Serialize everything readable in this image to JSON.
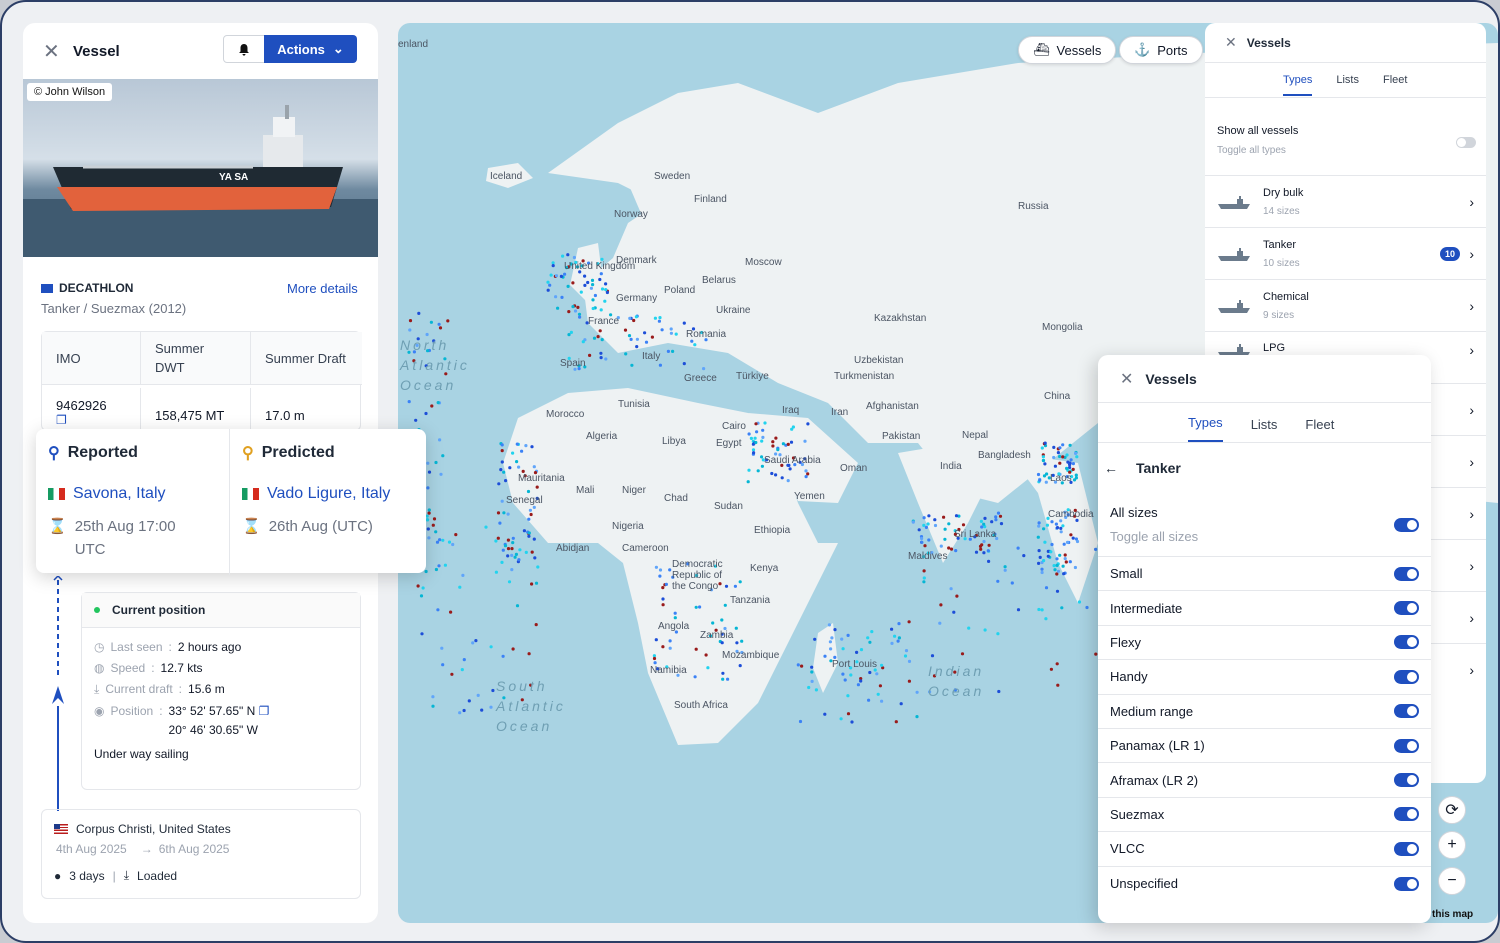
{
  "vessel_panel": {
    "title": "Vessel",
    "actions_label": "Actions",
    "photo_credit": "© John Wilson",
    "vessel_name": "DECATHLON",
    "vessel_type": "Tanker / Suezmax (2012)",
    "more_details": "More details",
    "specs": {
      "headers": [
        "IMO",
        "Summer DWT",
        "Summer Draft"
      ],
      "values": [
        "9462926",
        "158,475 MT",
        "17.0 m"
      ]
    },
    "reported": {
      "title": "Reported",
      "port": "Savona, Italy",
      "time": "25th Aug 17:00 UTC"
    },
    "predicted": {
      "title": "Predicted",
      "port": "Vado Ligure, Italy",
      "time": "26th Aug (UTC)"
    },
    "current_position": {
      "title": "Current position",
      "last_seen_label": "Last seen",
      "last_seen": "2 hours ago",
      "speed_label": "Speed",
      "speed": "12.7 kts",
      "draft_label": "Current draft",
      "draft": "15.6 m",
      "position_label": "Position",
      "lat": "33° 52' 57.65\" N",
      "lon": "20° 46' 30.65\" W",
      "status": "Under way sailing"
    },
    "previous_port": {
      "name": "Corpus Christi, United States",
      "arrival": "4th Aug 2025",
      "departure": "6th Aug 2025",
      "duration": "3 days",
      "load_state": "Loaded"
    }
  },
  "map": {
    "buttons": {
      "vessels": "Vessels",
      "ports": "Ports"
    },
    "attribution": "this map",
    "labels": [
      "Iceland",
      "Sweden",
      "Finland",
      "Norway",
      "Russia",
      "Denmark",
      "United Kingdom",
      "Belarus",
      "Moscow",
      "Poland",
      "Germany",
      "Ukraine",
      "France",
      "Kazakhstan",
      "Mongolia",
      "Romania",
      "Spain",
      "Italy",
      "Uzbekistan",
      "Türkiye",
      "Turkmenistan",
      "Greece",
      "Afghanistan",
      "Tunisia",
      "Iraq",
      "Iran",
      "China",
      "Morocco",
      "Algeria",
      "Libya",
      "Egypt",
      "Cairo",
      "Pakistan",
      "Nepal",
      "Bangladesh",
      "Saudi Arabia",
      "India",
      "Oman",
      "Laos",
      "Mauritania",
      "Mali",
      "Niger",
      "Chad",
      "Sudan",
      "Yemen",
      "Senegal",
      "Nigeria",
      "Ethiopia",
      "Cambodia",
      "Sri Lanka",
      "Abidjan",
      "Cameroon",
      "Democratic Republic of the Congo",
      "Kenya",
      "Tanzania",
      "Maldives",
      "Angola",
      "Zambia",
      "Mozambique",
      "Namibia",
      "Port Louis",
      "South Africa",
      "Finland"
    ],
    "oceans": {
      "north_atlantic": "North\nAtlantic\nOcean",
      "south_atlantic": "South\nAtlantic\nOcean",
      "indian": "Indian\nOcean"
    },
    "partial_label": "enland"
  },
  "vessels_back": {
    "title": "Vessels",
    "tabs": [
      "Types",
      "Lists",
      "Fleet"
    ],
    "show_all_label": "Show all vessels",
    "show_all_sub": "Toggle all types",
    "types": [
      {
        "name": "Dry bulk",
        "sizes": "14 sizes",
        "badge": ""
      },
      {
        "name": "Tanker",
        "sizes": "10 sizes",
        "badge": "10"
      },
      {
        "name": "Chemical",
        "sizes": "9 sizes",
        "badge": ""
      },
      {
        "name": "LPG",
        "sizes": "",
        "badge": ""
      }
    ]
  },
  "vessels_front": {
    "title": "Vessels",
    "tabs": [
      "Types",
      "Lists",
      "Fleet"
    ],
    "category": "Tanker",
    "all_sizes_label": "All sizes",
    "all_sizes_sub": "Toggle all sizes",
    "sizes": [
      "Small",
      "Intermediate",
      "Flexy",
      "Handy",
      "Medium range",
      "Panamax (LR 1)",
      "Aframax (LR 2)",
      "Suezmax",
      "VLCC",
      "Unspecified"
    ]
  },
  "colors": {
    "accent": "#1f4fbf",
    "ocean": "#a9d3e3",
    "land": "#eef2f3"
  }
}
